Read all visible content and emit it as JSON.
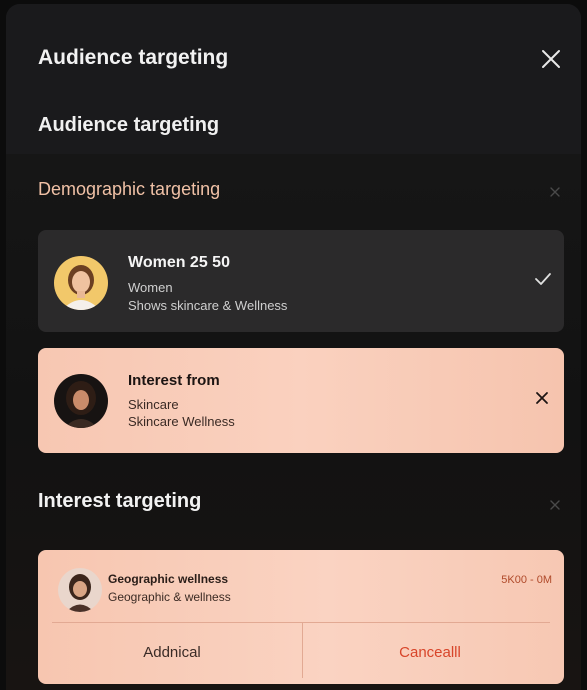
{
  "header": {
    "title": "Audience targeting",
    "subtitle": "Audience targeting"
  },
  "demographic": {
    "title": "Demographic targeting",
    "cards": [
      {
        "title": "Women 25 50",
        "line1": "Women",
        "line2": "Shows skincare & Wellness"
      },
      {
        "title": "Interest from",
        "line1": "Skincare",
        "line2": "Skincare Wellness"
      }
    ]
  },
  "interest": {
    "title": "Interest targeting",
    "item": {
      "title": "Geographic wellness",
      "subtitle": "Geographic & wellness",
      "meta": "5K00 - 0M"
    },
    "actions": {
      "add_label": "Addnical",
      "cancel_label": "Cancealll"
    }
  },
  "colors": {
    "accent_peach": "#fad1bf",
    "cancel_red": "#d8452a",
    "section_title_peach": "#f0c1a6"
  },
  "icons": {
    "close": "close-icon",
    "check": "check-icon",
    "remove": "close-icon"
  }
}
